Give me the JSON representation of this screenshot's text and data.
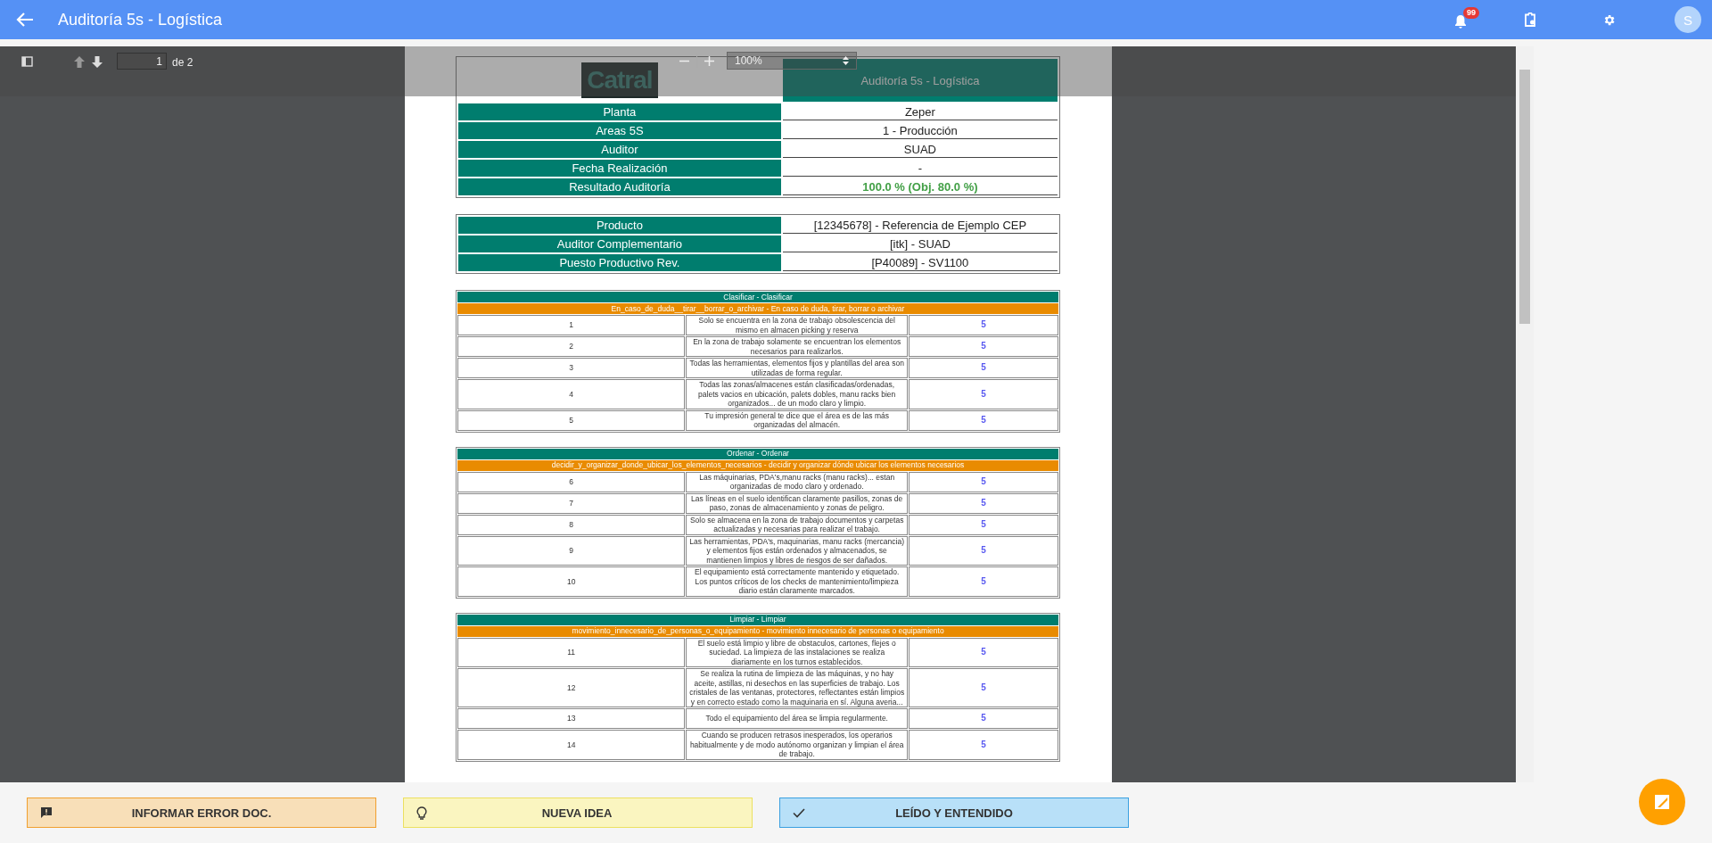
{
  "app_bar": {
    "title": "Auditoría 5s - Logística",
    "notification_count": "99",
    "avatar_letter": "S"
  },
  "pdf_toolbar": {
    "page": "1",
    "page_total": "de 2",
    "zoom": "100%"
  },
  "document": {
    "logo_text": "Catral",
    "title": "Auditoría 5s - Logística",
    "info_rows": [
      {
        "label": "Planta",
        "value": "Zeper",
        "kind": "text"
      },
      {
        "label": "Areas 5S",
        "value": "1 - Producción",
        "kind": "text"
      },
      {
        "label": "Auditor",
        "value": "SUAD",
        "kind": "text"
      },
      {
        "label": "Fecha Realización",
        "value": "-",
        "kind": "text"
      },
      {
        "label": "Resultado Auditoría",
        "value": "100.0 % (Obj. 80.0 %)",
        "kind": "result"
      }
    ],
    "product_rows": [
      {
        "label": "Producto",
        "value": "[12345678] - Referencia de Ejemplo CEP"
      },
      {
        "label": "Auditor Complementario",
        "value": "[itk] - SUAD"
      },
      {
        "label": "Puesto Productivo Rev.",
        "value": "[P40089] - SV1100"
      }
    ],
    "sections": [
      {
        "title": "Clasificar - Clasificar",
        "subtitle": "En_caso_de_duda__tirar__borrar_o_archivar - En caso de duda, tirar, borrar o archivar",
        "items": [
          {
            "number": "1",
            "question": "Solo se encuentra en la zona de trabajo obsolescencia del mismo en almacen picking y reserva",
            "score": "5"
          },
          {
            "number": "2",
            "question": "En la zona de trabajo solamente se encuentran los elementos necesarios para realizarlos.",
            "score": "5"
          },
          {
            "number": "3",
            "question": "Todas las herramientas, elementos fijos y plantillas del area son utilizadas de forma regular.",
            "score": "5"
          },
          {
            "number": "4",
            "question": "Todas las zonas/almacenes están clasificadas/ordenadas, palets vacios en ubicación, palets dobles, manu racks bien organizados... de un modo claro y limpio.",
            "score": "5"
          },
          {
            "number": "5",
            "question": "Tu impresión general te dice que el área es de las más organizadas del almacén.",
            "score": "5"
          }
        ]
      },
      {
        "title": "Ordenar - Ordenar",
        "subtitle": "decidir_y_organizar_donde_ubicar_los_elementos_necesarios - decidir y organizar dónde ubicar los elementos necesarios",
        "items": [
          {
            "number": "6",
            "question": "Las máquinarias, PDA's,manu racks (manu racks)... estan organizadas de modo claro y ordenado.",
            "score": "5"
          },
          {
            "number": "7",
            "question": "Las líneas en el suelo identifican claramente pasillos, zonas de paso, zonas de almacenamiento y zonas de peligro.",
            "score": "5"
          },
          {
            "number": "8",
            "question": "Solo se almacena en la zona de trabajo documentos y carpetas actualizadas y necesarias para realizar el trabajo.",
            "score": "5"
          },
          {
            "number": "9",
            "question": "Las herramientas, PDA's, maquinarias, manu racks (mercancia) y elementos fijos están ordenados y almacenados, se mantienen limpios y libres de riesgos de ser dañados.",
            "score": "5"
          },
          {
            "number": "10",
            "question": "El equipamiento está correctamente mantenido y etiquetado. Los puntos críticos de los checks de mantenimiento/limpieza diario están claramente marcados.",
            "score": "5"
          }
        ]
      },
      {
        "title": "Limpiar - Limpiar",
        "subtitle": "movimiento_innecesario_de_personas_o_equipamiento - movimiento innecesario de personas o equipamiento",
        "items": [
          {
            "number": "11",
            "question": "El suelo está limpio y libre de obstaculos, cartones, flejes o suciedad. La limpieza de las instalaciones se realiza diariamente en los turnos establecidos.",
            "score": "5"
          },
          {
            "number": "12",
            "question": "Se realiza la rutina de limpieza de las máquinas, y no hay aceite, astillas, ni desechos en las superficies de trabajo. Los cristales de las ventanas, protectores, reflectantes están limpios y en correcto estado como la maquinaria en sí. Alguna averia...",
            "score": "5"
          },
          {
            "number": "13",
            "question": "Todo el equipamiento del área se limpia regularmente.",
            "score": "5"
          },
          {
            "number": "14",
            "question": "Cuando se producen retrasos inesperados, los operarios habitualmente y de modo autónomo organizan y limpian el área de trabajo.",
            "score": "5"
          }
        ]
      }
    ]
  },
  "actions": [
    {
      "label": "INFORMAR ERROR DOC.",
      "kind": "error"
    },
    {
      "label": "NUEVA IDEA",
      "kind": "idea"
    },
    {
      "label": "LEÍDO Y ENTENDIDO",
      "kind": "read"
    }
  ]
}
